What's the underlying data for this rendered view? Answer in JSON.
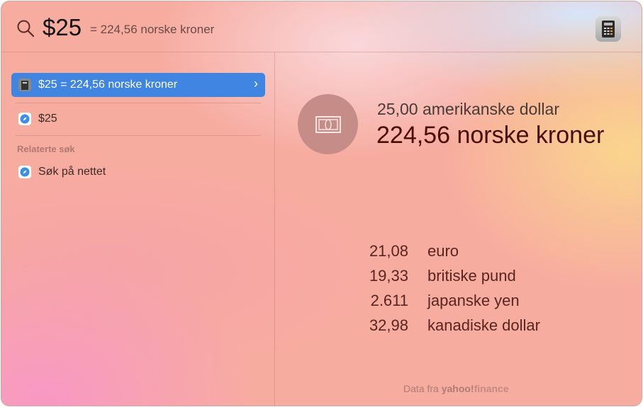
{
  "search": {
    "query": "$25",
    "hint": "= 224,56 norske kroner"
  },
  "results": [
    {
      "label": "$25 = 224,56 norske kroner",
      "icon": "calculator-icon",
      "selected": true
    },
    {
      "label": "$25",
      "icon": "safari-icon"
    }
  ],
  "related": {
    "title": "Relaterte søk",
    "items": [
      {
        "label": "Søk på nettet",
        "icon": "safari-icon"
      }
    ]
  },
  "preview": {
    "from": "25,00 amerikanske dollar",
    "to": "224,56 norske kroner",
    "rates": [
      {
        "value": "21,08",
        "name": "euro"
      },
      {
        "value": "19,33",
        "name": "britiske pund"
      },
      {
        "value": "2.611",
        "name": "japanske yen"
      },
      {
        "value": "32,98",
        "name": "kanadiske dollar"
      }
    ],
    "source_prefix": "Data fra",
    "source_brand": "yahoo!",
    "source_brand2": "finance"
  },
  "colors": {
    "accent": "#3f85e1"
  }
}
